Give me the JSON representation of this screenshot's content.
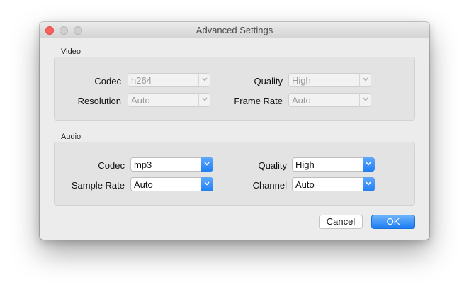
{
  "window": {
    "title": "Advanced Settings"
  },
  "video": {
    "section_label": "Video",
    "codec": {
      "label": "Codec",
      "value": "h264"
    },
    "resolution": {
      "label": "Resolution",
      "value": "Auto"
    },
    "quality": {
      "label": "Quality",
      "value": "High"
    },
    "frame_rate": {
      "label": "Frame Rate",
      "value": "Auto"
    }
  },
  "audio": {
    "section_label": "Audio",
    "codec": {
      "label": "Codec",
      "value": "mp3"
    },
    "sample_rate": {
      "label": "Sample Rate",
      "value": "Auto"
    },
    "quality": {
      "label": "Quality",
      "value": "High"
    },
    "channel": {
      "label": "Channel",
      "value": "Auto"
    }
  },
  "buttons": {
    "cancel": "Cancel",
    "ok": "OK"
  },
  "colors": {
    "accent": "#1f7ef5",
    "close": "#fc605c"
  }
}
